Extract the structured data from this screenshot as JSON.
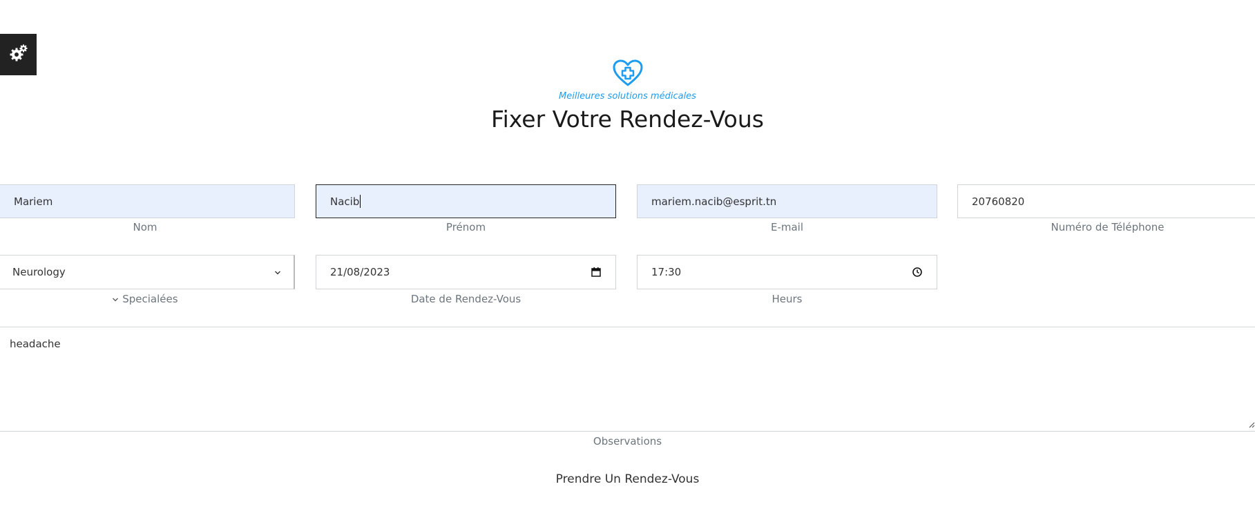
{
  "header": {
    "tagline": "Meilleures solutions médicales",
    "title": "Fixer Votre Rendez-Vous",
    "logo_icon": "heart-medical-icon",
    "accent_color": "#1e9cf0"
  },
  "settings": {
    "icon": "gears-icon"
  },
  "form": {
    "nom": {
      "value": "Mariem",
      "label": "Nom"
    },
    "prenom": {
      "value": "Nacib",
      "label": "Prénom"
    },
    "email": {
      "value": "mariem.nacib@esprit.tn",
      "label": "E-mail"
    },
    "telephone": {
      "value": "20760820",
      "label": "Numéro de Téléphone"
    },
    "specialite": {
      "value": "Neurology",
      "label": "Specialées"
    },
    "date": {
      "value": "21/08/2023",
      "label": "Date de Rendez-Vous"
    },
    "heure": {
      "value": "17:30",
      "label": "Heurs"
    },
    "observations": {
      "value": "headache",
      "label": "Observations"
    },
    "submit_label": "Prendre Un Rendez-Vous"
  }
}
